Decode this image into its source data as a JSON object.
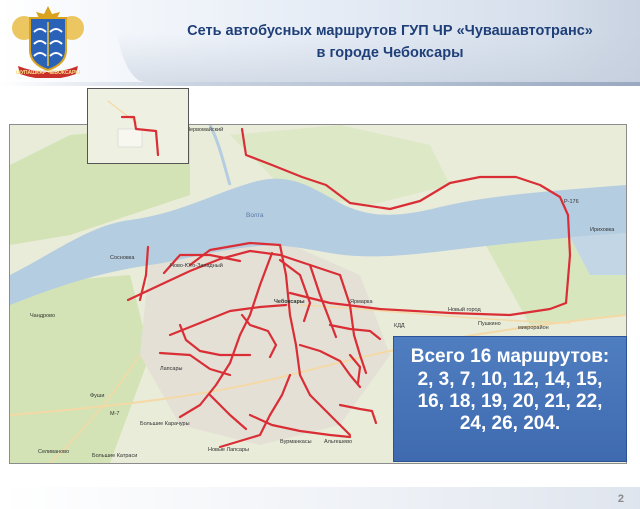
{
  "header": {
    "title_line1": "Сеть автобусных маршрутов ГУП ЧР «Чувашавтотранс»",
    "title_line2": "в городе Чебоксары",
    "emblem_ribbon": "ШУПАШКАР ЧЕБОКСАРЫ"
  },
  "map": {
    "labels": {
      "pervomaysky": "Первомайский",
      "volga": "Волга",
      "cheboksary": "Чебоксары",
      "novy_gorod": "Новый город",
      "irikhovka": "Ириховка",
      "novo_yugo_zapadny": "Ново-Юго-Западный",
      "chandrovo": "Чандрово",
      "yarmarka": "Ярмарка",
      "kugesi_road": "Лапсары",
      "bolshie_karachury": "Большие Карачуры",
      "novye_lapsary": "Новые Лапсары",
      "vurmankasy": "Вурманкасы",
      "altysheva": "Альгешево",
      "selivanovo": "Селиваново",
      "bolshie_katraci": "Большие Катраси",
      "m7": "М-7",
      "fushi": "Фуши",
      "pushkino": "Пушкино",
      "mikroraion": "микрорайон",
      "r176": "Р-176",
      "kdd": "КДД",
      "sosnovka": "Сосновка"
    }
  },
  "info_box": {
    "title": "Всего 16 маршрутов:",
    "lines": [
      "2, 3, 7, 10, 12, 14, 15,",
      "16, 18, 19, 20, 21, 22,",
      "24, 26, 204."
    ]
  },
  "footer": {
    "page_number": "2"
  },
  "colors": {
    "route": "#d92e35",
    "water": "#b5cde0",
    "land": "#e9ecd9",
    "forest": "#cfe0b0",
    "title": "#1e3f78",
    "info_bg": "#4a79bd"
  }
}
